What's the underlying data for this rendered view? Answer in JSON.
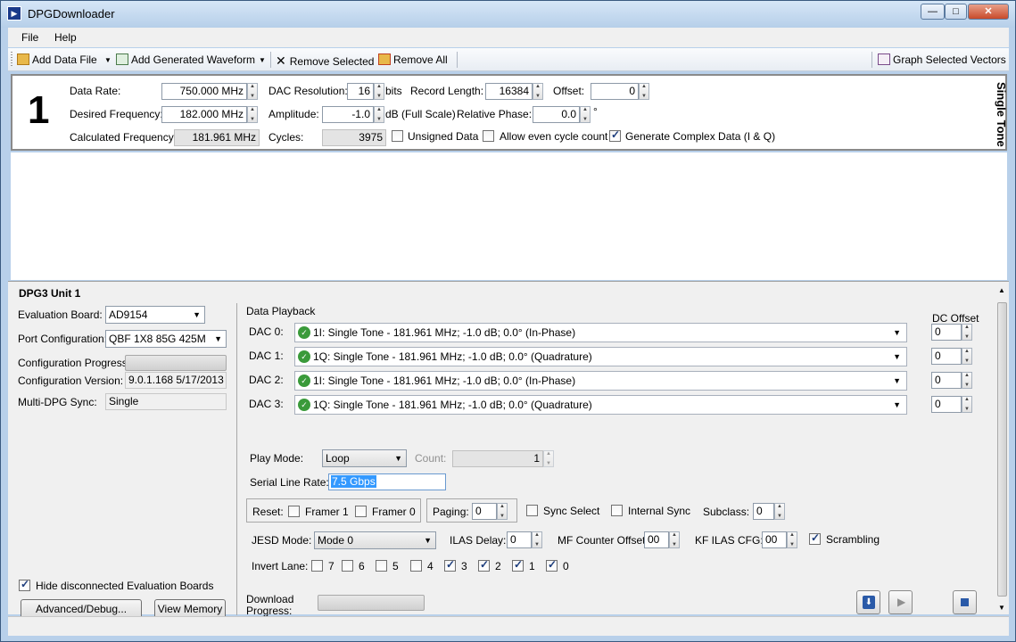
{
  "window": {
    "title": "DPGDownloader",
    "minimize": "—",
    "maximize": "□",
    "close": "✕"
  },
  "menu": {
    "file": "File",
    "help": "Help"
  },
  "toolbar": {
    "add_data_file": "Add Data File",
    "add_generated_waveform": "Add Generated Waveform",
    "remove_selected": "Remove Selected",
    "remove_all": "Remove All",
    "graph_selected_vectors": "Graph Selected Vectors"
  },
  "waveform": {
    "index": "1",
    "type_label": "Single Tone",
    "data_rate_label": "Data Rate:",
    "data_rate": "750.000 MHz",
    "desired_freq_label": "Desired Frequency:",
    "desired_freq": "182.000 MHz",
    "calc_freq_label": "Calculated Frequency:",
    "calc_freq": "181.961 MHz",
    "dac_res_label": "DAC Resolution:",
    "dac_res": "16",
    "dac_res_unit": "bits",
    "amplitude_label": "Amplitude:",
    "amplitude": "-1.0",
    "amplitude_unit": "dB (Full Scale)",
    "cycles_label": "Cycles:",
    "cycles": "3975",
    "record_length_label": "Record Length:",
    "record_length": "16384",
    "offset_label": "Offset:",
    "offset": "0",
    "rel_phase_label": "Relative Phase:",
    "rel_phase": "0.0",
    "rel_phase_unit": "°",
    "unsigned_label": "Unsigned Data",
    "even_cycle_label": "Allow even cycle count",
    "complex_label": "Generate Complex Data (I & Q)"
  },
  "unit": {
    "title": "DPG3 Unit 1",
    "eval_board_label": "Evaluation Board:",
    "eval_board": "AD9154",
    "port_config_label": "Port Configuration:",
    "port_config": "QBF 1X8 85G 425M",
    "config_progress_label": "Configuration Progress:",
    "config_version_label": "Configuration Version:",
    "config_version": "9.0.1.168 5/17/2013",
    "multi_sync_label": "Multi-DPG Sync:",
    "multi_sync": "Single",
    "hide_disconnected_label": "Hide disconnected Evaluation Boards",
    "advanced_button": "Advanced/Debug...",
    "view_memory_button": "View Memory"
  },
  "playback": {
    "title": "Data Playback",
    "dc_offset_label": "DC Offset",
    "dacs": [
      {
        "label": "DAC 0:",
        "value": "1I: Single Tone - 181.961 MHz; -1.0 dB; 0.0° (In-Phase)",
        "dc": "0"
      },
      {
        "label": "DAC 1:",
        "value": "1Q: Single Tone - 181.961 MHz; -1.0 dB; 0.0° (Quadrature)",
        "dc": "0"
      },
      {
        "label": "DAC 2:",
        "value": "1I: Single Tone - 181.961 MHz; -1.0 dB; 0.0° (In-Phase)",
        "dc": "0"
      },
      {
        "label": "DAC 3:",
        "value": "1Q: Single Tone - 181.961 MHz; -1.0 dB; 0.0° (Quadrature)",
        "dc": "0"
      }
    ],
    "play_mode_label": "Play Mode:",
    "play_mode": "Loop",
    "count_label": "Count:",
    "count": "1",
    "serial_rate_label": "Serial Line Rate:",
    "serial_rate": "7.5 Gbps",
    "reset_label": "Reset:",
    "framer1_label": "Framer 1",
    "framer0_label": "Framer 0",
    "paging_label": "Paging:",
    "paging": "0",
    "sync_select_label": "Sync Select",
    "internal_sync_label": "Internal Sync",
    "subclass_label": "Subclass:",
    "subclass": "0",
    "jesd_mode_label": "JESD Mode:",
    "jesd_mode": "Mode 0",
    "ilas_delay_label": "ILAS Delay:",
    "ilas_delay": "0",
    "mf_counter_label": "MF Counter Offset:",
    "mf_counter": "00",
    "kf_ilas_label": "KF ILAS CFG:",
    "kf_ilas": "00",
    "scrambling_label": "Scrambling",
    "invert_lane_label": "Invert Lane:",
    "lanes": [
      {
        "label": "7",
        "checked": false
      },
      {
        "label": "6",
        "checked": false
      },
      {
        "label": "5",
        "checked": false
      },
      {
        "label": "4",
        "checked": false
      },
      {
        "label": "3",
        "checked": true
      },
      {
        "label": "2",
        "checked": true
      },
      {
        "label": "1",
        "checked": true
      },
      {
        "label": "0",
        "checked": true
      }
    ],
    "download_progress_label": "Download\nProgress:"
  }
}
